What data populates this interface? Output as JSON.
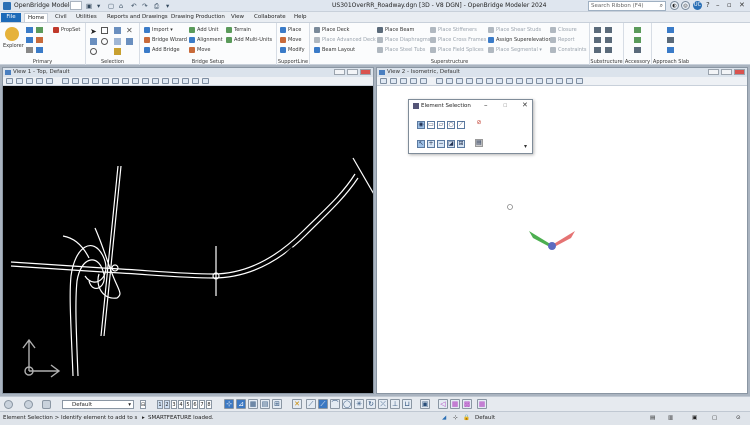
{
  "title_bar": {
    "app_name": "OpenBridge Modeler",
    "document_title": "US301OverRR_Roadway.dgn [3D - V8 DGN] - OpenBridge Modeler 2024",
    "search_placeholder": "Search Ribbon (F4)",
    "user_initials": "UC"
  },
  "ribbon_tabs": [
    {
      "label": "File"
    },
    {
      "label": "Home"
    },
    {
      "label": "Civil"
    },
    {
      "label": "Utilities"
    },
    {
      "label": "Reports and Drawings"
    },
    {
      "label": "Drawing Production"
    },
    {
      "label": "View"
    },
    {
      "label": "Collaborate"
    },
    {
      "label": "Help"
    }
  ],
  "ribbon": {
    "primary": {
      "label": "Primary",
      "explorer": "Explorer",
      "propset": "PropSet"
    },
    "selection": {
      "label": "Selection"
    },
    "bridge_setup": {
      "label": "Bridge Setup",
      "import": "Import",
      "bridge_wizard": "Bridge Wizard",
      "add_bridge": "Add Bridge",
      "add_unit": "Add Unit",
      "alignment": "Alignment",
      "move": "Move",
      "terrain": "Terrain",
      "add_multi_units": "Add Multi-Units"
    },
    "support_line": {
      "label": "SupportLine",
      "place": "Place",
      "move": "Move",
      "modify": "Modify"
    },
    "superstructure": {
      "label": "Superstructure",
      "place_deck": "Place Deck",
      "place_advanced_deck": "Place Advanced Deck",
      "beam_layout": "Beam Layout",
      "place_beam": "Place Beam",
      "place_diaphragms": "Place Diaphragms",
      "place_steel_tubs": "Place Steel Tubs",
      "place_stiffeners": "Place Stiffeners",
      "place_cross_frames": "Place Cross Frames",
      "place_field_splices": "Place Field Splices",
      "place_shear_studs": "Place Shear Studs",
      "assign_superelevation": "Assign Superelevation",
      "place_segmental": "Place Segmental",
      "closure": "Closure",
      "report": "Report",
      "constraints": "Constraints"
    },
    "substructure": {
      "label": "Substructure"
    },
    "accessory": {
      "label": "Accessory"
    },
    "approach_slab": {
      "label": "Approach Slab"
    }
  },
  "views": {
    "view1_title": "View 1 - Top, Default",
    "view2_title": "View 2 - Isometric, Default"
  },
  "element_selection": {
    "title": "Element Selection"
  },
  "bottom_toolbar": {
    "level": "Default",
    "view_numbers": [
      "1",
      "2",
      "3",
      "4",
      "5",
      "6",
      "7",
      "8"
    ]
  },
  "status_bar": {
    "prompt": "Element Selection > Identify element to add to s",
    "message": "SMARTFEATURE loaded.",
    "active_level": "Default"
  },
  "colors": {
    "accent": "#1d6ab8",
    "view1_background": "#000000",
    "view2_background": "#ffffff"
  }
}
